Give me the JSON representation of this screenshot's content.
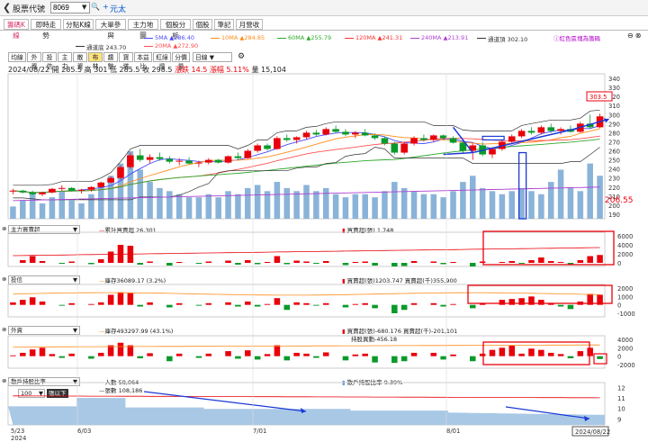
{
  "topbar": {
    "title": "股票代號",
    "code_input": "8069",
    "stock_name": "元太"
  },
  "tabs": [
    "籌碼K線",
    "即時走勢",
    "分點K線",
    "大單參與",
    "主力地圖",
    "個股分析",
    "個股",
    "筆記",
    "月營收"
  ],
  "active_tab": 0,
  "legend1": [
    {
      "label": "5MA",
      "value": "▲286.40",
      "color": "#4a4aff"
    },
    {
      "label": "10MA",
      "value": "▲284.85",
      "color": "#ff8c1a"
    },
    {
      "label": "60MA",
      "value": "▲255.79",
      "color": "#2eaa2e"
    },
    {
      "label": "120MA",
      "value": "▲241.31",
      "color": "#ff3030"
    },
    {
      "label": "240MA",
      "value": "▲213.91",
      "color": "#b040d0"
    },
    {
      "label": "通道頂",
      "value": "302.10",
      "color": "#333333"
    }
  ],
  "legend2": [
    {
      "label": "通道底",
      "value": "243.70",
      "color": "#333333"
    },
    {
      "label": "20MA",
      "value": "▲272.90",
      "color": "#ff5050"
    }
  ],
  "right_link": "ⓘ紅色區塊為籌碼",
  "subtabs": [
    "均線",
    "外資",
    "投信",
    "主力",
    "散資",
    "布林",
    "趨勢",
    "寶塔",
    "本益比",
    "紅綠燈",
    "分價量"
  ],
  "active_subtab": 5,
  "period_select": "日線",
  "summary": {
    "date": "2024/08/22",
    "open": "開 285.5",
    "high": "高 301",
    "low": "低 285.5",
    "close": "收 298.5",
    "change": "漲跌 14.5",
    "pct": "漲幅 5.11%",
    "vol": "量 15,104"
  },
  "main_axis": [
    "340",
    "330",
    "320",
    "310",
    "300",
    "290",
    "280",
    "270",
    "260",
    "250",
    "240",
    "230",
    "220",
    "210",
    "200",
    "190"
  ],
  "price_tag": "303.5",
  "price_left_tag": "206.55",
  "panels": {
    "p1": {
      "name": "主力買賣超",
      "left_label": "累計買賣超",
      "left_value": "26,301",
      "right_label": "買賣超(張)",
      "right_value": "1,748",
      "axis": [
        "6000",
        "4000",
        "2000",
        "0"
      ]
    },
    "p2": {
      "name": "投信",
      "left_label": "庫存36089.17 (3.2%)",
      "right_label": "買賣超(張)1203.747 買賣超(千)355,900",
      "axis": [
        "2000",
        "1000",
        "0",
        "-1000"
      ]
    },
    "p3": {
      "name": "外資",
      "left_label": "庫存493297.99 (43.1%)",
      "right_label": "買賣超(張)-680.176 買賣超(千)-201,101",
      "right_label2": "持股異動-456.18",
      "axis": [
        "4000",
        "2000",
        "0",
        "-2000"
      ]
    },
    "p4": {
      "name": "散戶持股比率",
      "left_label": "人數 58,064",
      "left_label2": "張數 108,186",
      "right_label": "散戶持股比率 9.39%",
      "pick_value": "100",
      "pick_suffix": "張以下",
      "axis": [
        "12",
        "11",
        "10",
        "9"
      ]
    }
  },
  "xaxis": [
    "5/23",
    "2024",
    "6/03",
    "7/01",
    "8/01",
    "2024/08/22"
  ],
  "colors": {
    "up": "#e8000b",
    "down": "#0a9a2a",
    "vol": "#8ab3d9",
    "accent_blue": "#1a39d6",
    "annot_red": "#e8000b"
  },
  "chart_data": {
    "type": "candlestick",
    "title": "",
    "candles": [
      [
        215,
        218,
        212,
        216
      ],
      [
        216,
        217,
        213,
        214
      ],
      [
        214,
        216,
        211,
        212
      ],
      [
        212,
        215,
        210,
        214
      ],
      [
        214,
        219,
        213,
        218
      ],
      [
        218,
        222,
        216,
        219
      ],
      [
        219,
        220,
        215,
        216
      ],
      [
        216,
        218,
        213,
        217
      ],
      [
        217,
        221,
        215,
        220
      ],
      [
        220,
        226,
        219,
        225
      ],
      [
        225,
        232,
        224,
        230
      ],
      [
        230,
        244,
        228,
        242
      ],
      [
        242,
        258,
        240,
        255
      ],
      [
        255,
        262,
        248,
        250
      ],
      [
        250,
        256,
        246,
        253
      ],
      [
        253,
        258,
        249,
        251
      ],
      [
        251,
        254,
        246,
        248
      ],
      [
        248,
        252,
        244,
        249
      ],
      [
        249,
        253,
        245,
        246
      ],
      [
        246,
        249,
        242,
        247
      ],
      [
        247,
        252,
        245,
        250
      ],
      [
        250,
        251,
        246,
        247
      ],
      [
        247,
        255,
        246,
        254
      ],
      [
        254,
        258,
        250,
        252
      ],
      [
        252,
        262,
        251,
        260
      ],
      [
        260,
        268,
        258,
        266
      ],
      [
        266,
        268,
        260,
        262
      ],
      [
        262,
        276,
        261,
        274
      ],
      [
        274,
        278,
        270,
        272
      ],
      [
        272,
        276,
        268,
        275
      ],
      [
        275,
        282,
        273,
        280
      ],
      [
        280,
        283,
        276,
        278
      ],
      [
        278,
        286,
        277,
        284
      ],
      [
        284,
        288,
        279,
        281
      ],
      [
        281,
        284,
        276,
        278
      ],
      [
        278,
        282,
        274,
        280
      ],
      [
        280,
        284,
        276,
        277
      ],
      [
        277,
        279,
        272,
        274
      ],
      [
        274,
        276,
        266,
        268
      ],
      [
        268,
        270,
        256,
        258
      ],
      [
        258,
        270,
        256,
        268
      ],
      [
        268,
        276,
        266,
        274
      ],
      [
        274,
        278,
        270,
        272
      ],
      [
        272,
        278,
        270,
        277
      ],
      [
        277,
        278,
        272,
        274
      ],
      [
        274,
        276,
        268,
        269
      ],
      [
        269,
        270,
        258,
        260
      ],
      [
        260,
        268,
        250,
        266
      ],
      [
        266,
        270,
        254,
        256
      ],
      [
        256,
        264,
        252,
        262
      ],
      [
        262,
        272,
        260,
        270
      ],
      [
        270,
        278,
        268,
        276
      ],
      [
        276,
        284,
        274,
        282
      ],
      [
        282,
        286,
        278,
        280
      ],
      [
        280,
        288,
        278,
        286
      ],
      [
        286,
        290,
        280,
        282
      ],
      [
        282,
        286,
        278,
        284
      ],
      [
        284,
        288,
        280,
        281
      ],
      [
        281,
        292,
        280,
        290
      ],
      [
        290,
        300,
        284,
        286
      ],
      [
        286,
        301,
        285,
        298
      ]
    ],
    "volumes": [
      4,
      6,
      8,
      5,
      7,
      9,
      6,
      5,
      8,
      11,
      14,
      18,
      22,
      16,
      12,
      10,
      9,
      8,
      7,
      7,
      8,
      7,
      9,
      8,
      10,
      11,
      9,
      12,
      10,
      9,
      11,
      9,
      10,
      8,
      7,
      8,
      8,
      7,
      9,
      12,
      10,
      9,
      8,
      8,
      7,
      9,
      12,
      14,
      10,
      9,
      8,
      9,
      10,
      9,
      8,
      12,
      16,
      10,
      9,
      18,
      14
    ],
    "ylim": [
      185,
      345
    ]
  }
}
